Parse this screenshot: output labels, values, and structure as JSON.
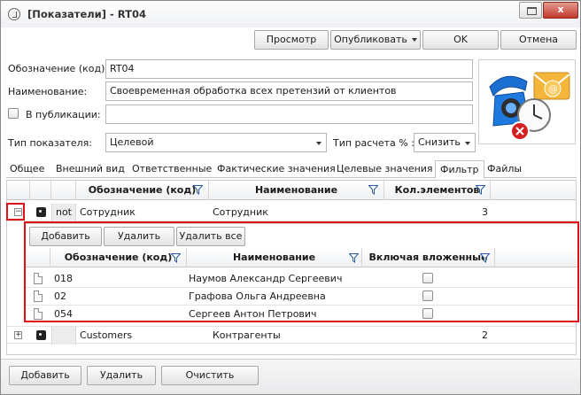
{
  "window": {
    "title": "[Показатели] - RT04",
    "close_glyph": "x"
  },
  "toolbar": {
    "preview_label": "Просмотр",
    "publish_label": "Опубликовать",
    "ok_label": "OK",
    "cancel_label": "Отмена"
  },
  "form": {
    "code_label": "Обозначение (код):",
    "code_value": "RT04",
    "name_label": "Наименование:",
    "name_value": "Своевременная обработка всех претензий от клиентов",
    "publish_label": "В публикации:",
    "publish_checked": false,
    "publish_value": "",
    "type_label": "Тип показателя:",
    "type_value": "Целевой",
    "calc_label": "Тип расчета % :",
    "calc_value": "Снизить"
  },
  "tabs": [
    {
      "label": "Общее",
      "active": false
    },
    {
      "label": "Внешний вид",
      "active": false
    },
    {
      "label": "Ответственные",
      "active": false
    },
    {
      "label": "Фактические значения",
      "active": false
    },
    {
      "label": "Целевые значения",
      "active": false
    },
    {
      "label": "Фильтр",
      "active": true
    },
    {
      "label": "Файлы",
      "active": false
    }
  ],
  "grid": {
    "columns": {
      "code": "Обозначение (код)",
      "name": "Наименование",
      "count": "Кол.элементов"
    },
    "rows": [
      {
        "expander": "−",
        "not_label": "not",
        "code": "Сотрудник",
        "name": "Сотрудник",
        "count": "3"
      },
      {
        "expander": "+",
        "not_label": "",
        "code": "Customers",
        "name": "Контрагенты",
        "count": "2"
      }
    ]
  },
  "subgrid": {
    "add_label": "Добавить",
    "delete_label": "Удалить",
    "delete_all_label": "Удалить все",
    "columns": {
      "code": "Обозначение (код)",
      "name": "Наименование",
      "include": "Включая вложенные"
    },
    "rows": [
      {
        "code": "018",
        "name": "Наумов Александр Сергеевич",
        "include": false
      },
      {
        "code": "02",
        "name": "Графова Ольга Андреевна",
        "include": false
      },
      {
        "code": "054",
        "name": "Сергеев Антон Петрович",
        "include": false
      }
    ]
  },
  "footer": {
    "add_label": "Добавить",
    "delete_label": "Удалить",
    "clear_label": "Очистить"
  },
  "colors": {
    "highlight": "#e0101a",
    "phone": "#1b6fd1",
    "envelope": "#f0a830",
    "error": "#d42020"
  }
}
